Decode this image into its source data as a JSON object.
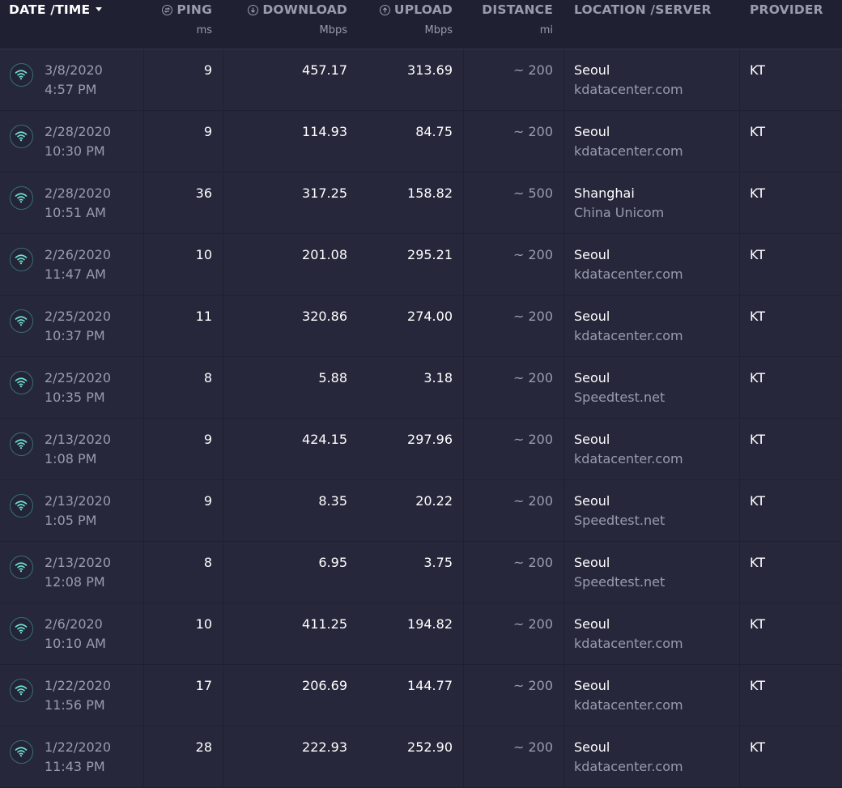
{
  "header": {
    "date_time": "DATE /TIME",
    "ping": "PING",
    "ping_unit": "ms",
    "download": "DOWNLOAD",
    "download_unit": "Mbps",
    "upload": "UPLOAD",
    "upload_unit": "Mbps",
    "distance": "DISTANCE",
    "distance_unit": "mi",
    "location": "LOCATION /SERVER",
    "provider": "PROVIDER"
  },
  "icons": {
    "connection": "wifi-icon",
    "ping": "ping-icon",
    "download": "download-arrow-icon",
    "upload": "upload-arrow-icon",
    "sort": "sort-caret-down-icon"
  },
  "colors": {
    "background": "#1f2032",
    "row": "#26273b",
    "accent": "#6fe3d6",
    "muted_text": "#9a9cae"
  },
  "rows": [
    {
      "date": "3/8/2020",
      "time": "4:57 PM",
      "ping": "9",
      "download": "457.17",
      "upload": "313.69",
      "distance": "~ 200",
      "location": "Seoul",
      "server": "kdatacenter.com",
      "provider": "KT"
    },
    {
      "date": "2/28/2020",
      "time": "10:30 PM",
      "ping": "9",
      "download": "114.93",
      "upload": "84.75",
      "distance": "~ 200",
      "location": "Seoul",
      "server": "kdatacenter.com",
      "provider": "KT"
    },
    {
      "date": "2/28/2020",
      "time": "10:51 AM",
      "ping": "36",
      "download": "317.25",
      "upload": "158.82",
      "distance": "~ 500",
      "location": "Shanghai",
      "server": "China Unicom",
      "provider": "KT"
    },
    {
      "date": "2/26/2020",
      "time": "11:47 AM",
      "ping": "10",
      "download": "201.08",
      "upload": "295.21",
      "distance": "~ 200",
      "location": "Seoul",
      "server": "kdatacenter.com",
      "provider": "KT"
    },
    {
      "date": "2/25/2020",
      "time": "10:37 PM",
      "ping": "11",
      "download": "320.86",
      "upload": "274.00",
      "distance": "~ 200",
      "location": "Seoul",
      "server": "kdatacenter.com",
      "provider": "KT"
    },
    {
      "date": "2/25/2020",
      "time": "10:35 PM",
      "ping": "8",
      "download": "5.88",
      "upload": "3.18",
      "distance": "~ 200",
      "location": "Seoul",
      "server": "Speedtest.net",
      "provider": "KT"
    },
    {
      "date": "2/13/2020",
      "time": "1:08 PM",
      "ping": "9",
      "download": "424.15",
      "upload": "297.96",
      "distance": "~ 200",
      "location": "Seoul",
      "server": "kdatacenter.com",
      "provider": "KT"
    },
    {
      "date": "2/13/2020",
      "time": "1:05 PM",
      "ping": "9",
      "download": "8.35",
      "upload": "20.22",
      "distance": "~ 200",
      "location": "Seoul",
      "server": "Speedtest.net",
      "provider": "KT"
    },
    {
      "date": "2/13/2020",
      "time": "12:08 PM",
      "ping": "8",
      "download": "6.95",
      "upload": "3.75",
      "distance": "~ 200",
      "location": "Seoul",
      "server": "Speedtest.net",
      "provider": "KT"
    },
    {
      "date": "2/6/2020",
      "time": "10:10 AM",
      "ping": "10",
      "download": "411.25",
      "upload": "194.82",
      "distance": "~ 200",
      "location": "Seoul",
      "server": "kdatacenter.com",
      "provider": "KT"
    },
    {
      "date": "1/22/2020",
      "time": "11:56 PM",
      "ping": "17",
      "download": "206.69",
      "upload": "144.77",
      "distance": "~ 200",
      "location": "Seoul",
      "server": "kdatacenter.com",
      "provider": "KT"
    },
    {
      "date": "1/22/2020",
      "time": "11:43 PM",
      "ping": "28",
      "download": "222.93",
      "upload": "252.90",
      "distance": "~ 200",
      "location": "Seoul",
      "server": "kdatacenter.com",
      "provider": "KT"
    }
  ]
}
